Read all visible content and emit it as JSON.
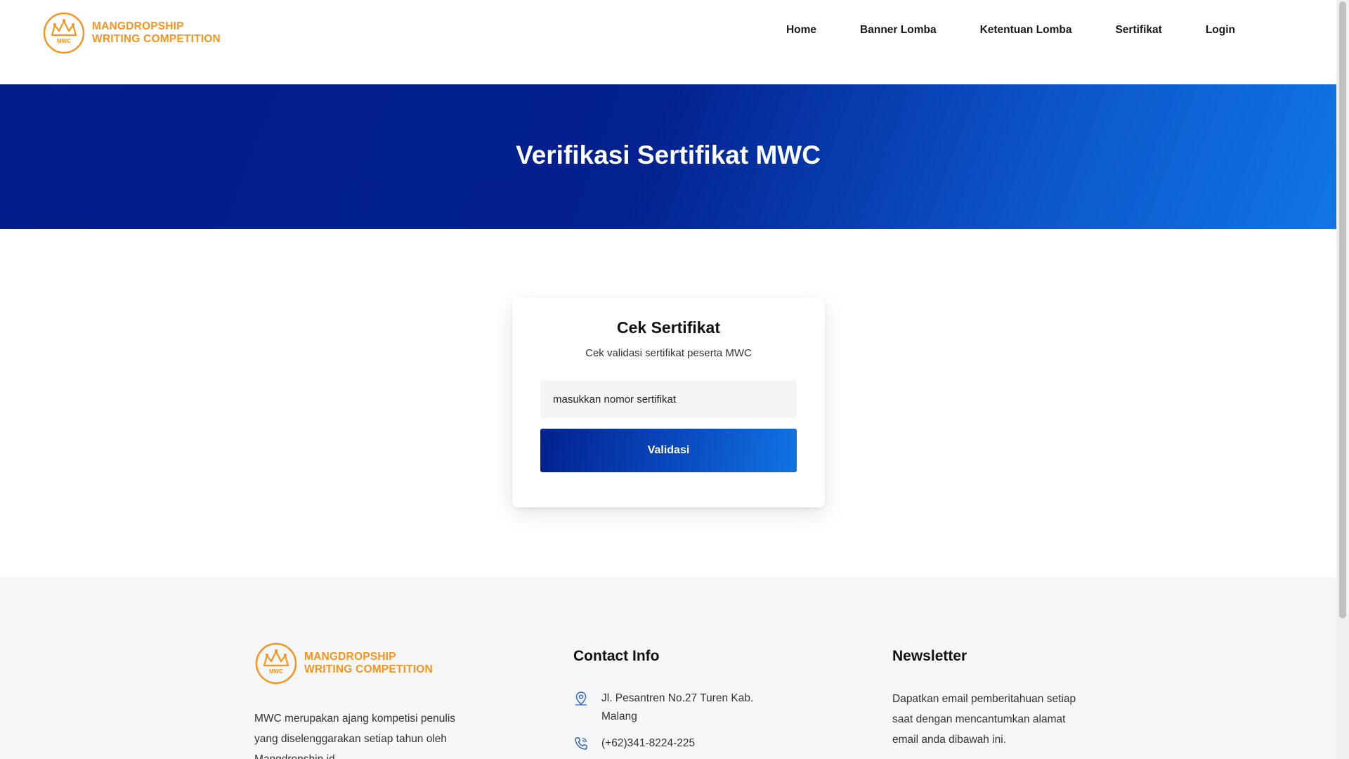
{
  "brand": {
    "line1": "MANGDROPSHIP",
    "line2": "WRITING COMPETITION",
    "badge": "MWC",
    "color": "#f7941d"
  },
  "nav": {
    "items": [
      {
        "label": "Home"
      },
      {
        "label": "Banner Lomba"
      },
      {
        "label": "Ketentuan Lomba"
      },
      {
        "label": "Sertifikat"
      },
      {
        "label": "Login"
      }
    ]
  },
  "hero": {
    "title": "Verifikasi Sertifikat MWC"
  },
  "card": {
    "title": "Cek Sertifikat",
    "subtitle": "Cek validasi sertifikat peserta MWC",
    "input_placeholder": "masukkan nomor sertifikat",
    "button_label": "Validasi"
  },
  "footer": {
    "about": "MWC merupakan ajang kompetisi penulis yang diselenggarakan setiap tahun oleh Mangdropship.id",
    "contact": {
      "heading": "Contact Info",
      "address": "Jl. Pesantren No.27 Turen Kab. Malang",
      "phone": "(+62)341-8224-225"
    },
    "newsletter": {
      "heading": "Newsletter",
      "text": "Dapatkan email pemberitahuan setiap saat dengan mencantumkan alamat email anda dibawah ini."
    }
  },
  "colors": {
    "hero_dark": "#011d88",
    "hero_light": "#1076e4",
    "accent": "#f7941d"
  },
  "icons": {
    "logo": "crown-logo-icon",
    "address": "map-pin-icon",
    "phone": "phone-icon"
  }
}
